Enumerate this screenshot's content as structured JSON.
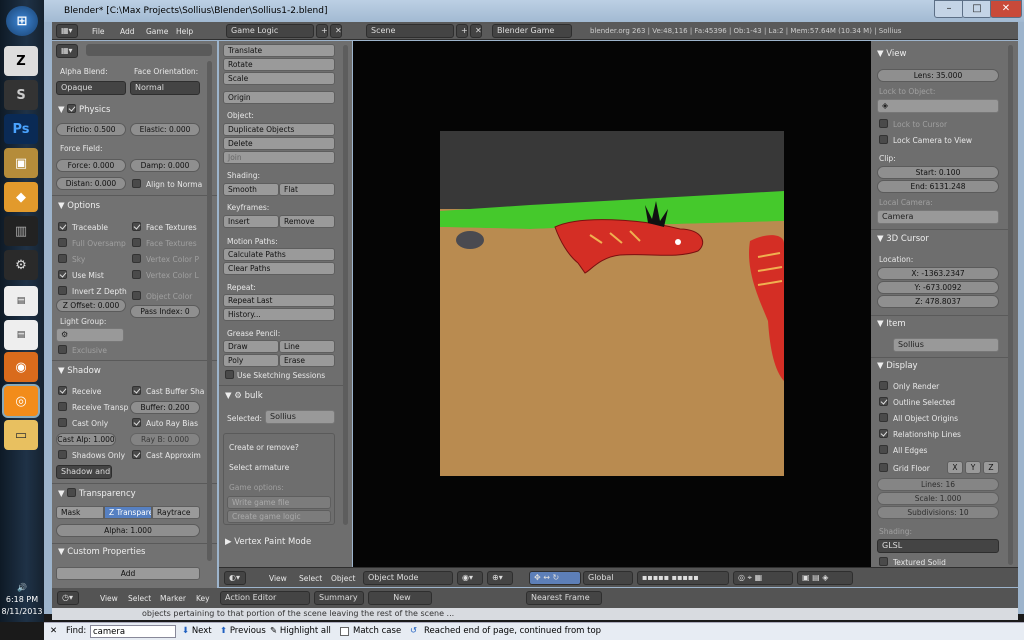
{
  "window": {
    "title": "Blender* [C:\\Max Projects\\Sollius\\Blender\\Sollius1-2.blend]",
    "min": "–",
    "max": "□",
    "close": "✕"
  },
  "taskbar": {
    "time": "6:18 PM",
    "date": "8/11/2013",
    "speaker": "🔊"
  },
  "info_header": {
    "menus": [
      "File",
      "Add",
      "Game",
      "Help"
    ],
    "screen_layout": "Game Logic",
    "scene": "Scene",
    "engine": "Blender Game",
    "stats": "blender.org 263 | Ve:48,116 | Fa:45396 | Ob:1-43 | La:2 | Mem:57.64M (10.34 M) | Sollius"
  },
  "left_panel": {
    "alpha_blend_label": "Alpha Blend:",
    "face_orientation_label": "Face Orientation:",
    "alpha_blend": "Opaque",
    "face_orientation": "Normal",
    "physics": {
      "title": "Physics",
      "friction": "Frictio: 0.500",
      "elastic": "Elastic: 0.000",
      "force_field": "Force Field:",
      "force": "Force: 0.000",
      "damp": "Damp: 0.000",
      "distance": "Distan: 0.000",
      "align_normal": "Align to Norma"
    },
    "options": {
      "title": "Options",
      "traceable": "Traceable",
      "face_textures": "Face Textures",
      "full_oversampling": "Full Oversamp",
      "face_textures_alpha": "Face Textures",
      "sky": "Sky",
      "vertex_color_paint": "Vertex Color P",
      "use_mist": "Use Mist",
      "vertex_color_light": "Vertex Color L",
      "invert_z_depth": "Invert Z Depth",
      "object_color": "Object Color",
      "z_offset": "Z Offset: 0.000",
      "pass_index": "Pass Index: 0",
      "light_group": "Light Group:",
      "exclusive": "Exclusive"
    },
    "shadow": {
      "title": "Shadow",
      "receive": "Receive",
      "cast_buffer": "Cast Buffer Sha",
      "receive_transparent": "Receive Transp",
      "buffer_bias": "Buffer: 0.200",
      "cast_only": "Cast Only",
      "auto_ray_bias": "Auto Ray Bias",
      "casting_alpha": "Cast Alp: 1.000",
      "ray_bias": "Ray B: 0.000",
      "shadows_only": "Shadows Only",
      "cast_approximate": "Cast Approxim",
      "shadow_mode": "Shadow and D"
    },
    "transparency": {
      "title": "Transparency",
      "mask": "Mask",
      "z_transparency": "Z Transparen",
      "raytrace": "Raytrace",
      "alpha": "Alpha: 1.000"
    },
    "custom_properties": {
      "title": "Custom Properties",
      "add": "Add"
    }
  },
  "tools": {
    "transform": [
      "Translate",
      "Rotate",
      "Scale"
    ],
    "origin": "Origin",
    "object_label": "Object:",
    "object": [
      "Duplicate Objects",
      "Delete",
      "Join"
    ],
    "shading_label": "Shading:",
    "smooth": "Smooth",
    "flat": "Flat",
    "keyframes_label": "Keyframes:",
    "insert": "Insert",
    "remove": "Remove",
    "motion_paths_label": "Motion Paths:",
    "calculate_paths": "Calculate Paths",
    "clear_paths": "Clear Paths",
    "repeat_label": "Repeat:",
    "repeat_last": "Repeat Last",
    "history": "History...",
    "grease_pencil_label": "Grease Pencil:",
    "draw": "Draw",
    "line": "Line",
    "poly": "Poly",
    "erase": "Erase",
    "use_sketching": "Use Sketching Sessions",
    "bulk": "bulk",
    "selected_label": "Selected:",
    "selected": "Sollius",
    "create_or_remove": "Create or remove?",
    "select_armature": "Select armature",
    "game_options": "Game options:",
    "write_game_file": "Write game file",
    "create_game_logic": "Create game logic",
    "vertex_paint_mode": "Vertex Paint Mode"
  },
  "right_panel": {
    "view": {
      "title": "View",
      "lens": "Lens: 35.000",
      "lock_to_object": "Lock to Object:",
      "lock_to_cursor": "Lock to Cursor",
      "lock_camera": "Lock Camera to View",
      "clip": "Clip:",
      "start": "Start: 0.100",
      "end": "End: 6131.248",
      "local_camera": "Local Camera:",
      "camera": "Camera"
    },
    "cursor": {
      "title": "3D Cursor",
      "location": "Location:",
      "x": "X: -1363.2347",
      "y": "Y: -673.0092",
      "z": "Z: 478.8037"
    },
    "item": {
      "title": "Item",
      "name": "Sollius"
    },
    "display": {
      "title": "Display",
      "only_render": "Only Render",
      "outline_selected": "Outline Selected",
      "all_object_origins": "All Object Origins",
      "relationship_lines": "Relationship Lines",
      "all_edges": "All Edges",
      "grid_floor": "Grid Floor",
      "x": "X",
      "y": "Y",
      "z": "Z",
      "lines": "Lines: 16",
      "scale": "Scale: 1.000",
      "subdivisions": "Subdivisions: 10",
      "shading": "Shading:",
      "shading_mode": "GLSL",
      "textured_solid": "Textured Solid"
    }
  },
  "view3d_header": {
    "menus": [
      "View",
      "Select",
      "Object"
    ],
    "mode": "Object Mode",
    "orientation": "Global"
  },
  "timeline_header": {
    "menus": [
      "View",
      "Select",
      "Marker",
      "Key"
    ],
    "editor": "Action Editor",
    "summary": "Summary",
    "new": "New",
    "frame": "Nearest Frame"
  },
  "page_text": "objects pertaining to that portion of the scene leaving the rest of the scene ...",
  "findbar": {
    "close": "✕",
    "find_label": "Find:",
    "query": "camera",
    "next": "Next",
    "previous": "Previous",
    "highlight_all": "Highlight all",
    "match_case": "Match case",
    "status": "Reached end of page, continued from top"
  }
}
